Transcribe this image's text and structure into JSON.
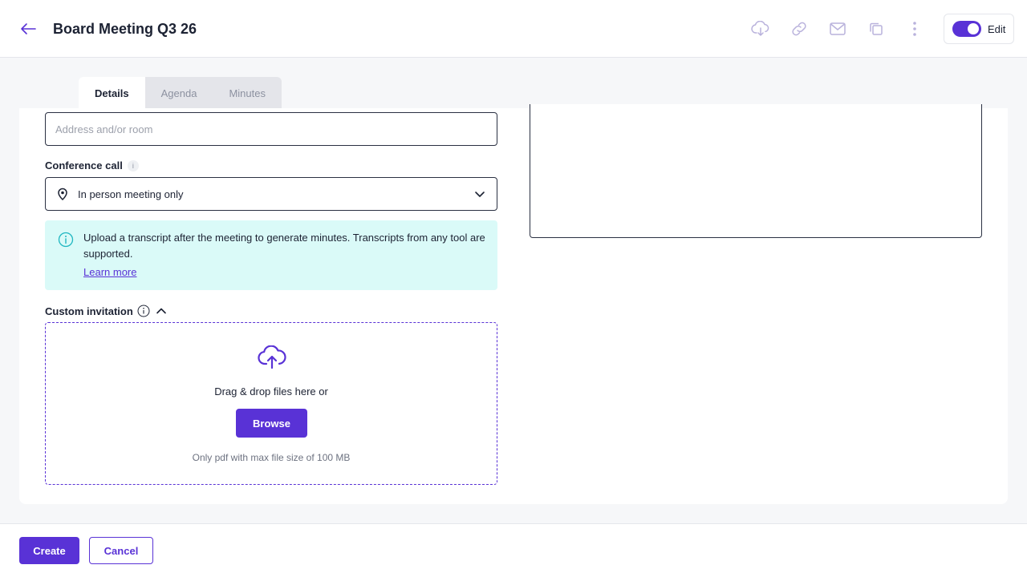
{
  "header": {
    "title": "Board Meeting Q3 26",
    "back_icon": "arrow-left-icon",
    "toolbar_icons": [
      "cloud-download-icon",
      "link-icon",
      "mail-icon",
      "copy-icon",
      "more-vertical-icon"
    ],
    "edit_label": "Edit",
    "edit_enabled": true
  },
  "tabs": [
    {
      "label": "Details",
      "active": true
    },
    {
      "label": "Agenda",
      "active": false
    },
    {
      "label": "Minutes",
      "active": false
    }
  ],
  "form": {
    "address_placeholder": "Address and/or room",
    "conference_label": "Conference call",
    "conference_value": "In person meeting only",
    "notice_text": "Upload a transcript after the meeting to generate minutes. Transcripts from any tool are supported.",
    "notice_link": "Learn more",
    "custom_invitation_label": "Custom invitation",
    "drop_text": "Drag & drop files here or",
    "browse_label": "Browse",
    "drop_hint": "Only pdf with max file size of 100 MB"
  },
  "footer": {
    "create_label": "Create",
    "cancel_label": "Cancel"
  },
  "colors": {
    "accent": "#5932d6",
    "notice_bg": "#dafaf8",
    "notice_icon": "#20b7c1"
  }
}
